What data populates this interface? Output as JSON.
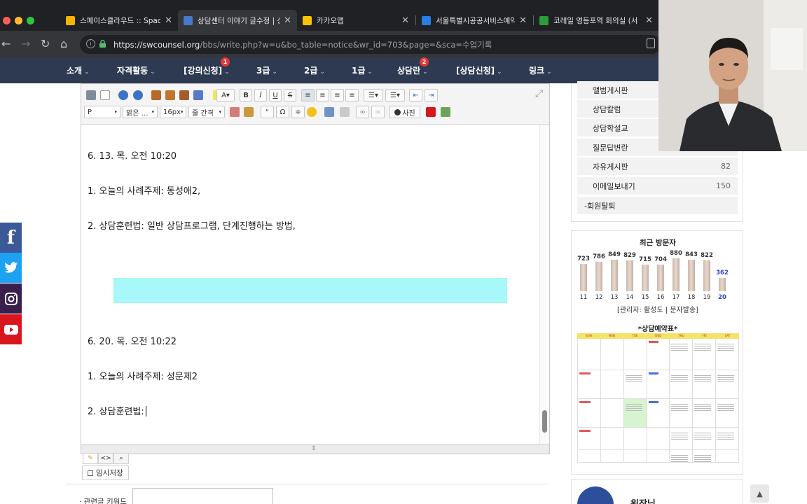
{
  "browser": {
    "tabs": [
      {
        "title": "스페이스클라우드 :: Space",
        "favicon_color": "#f5b400"
      },
      {
        "title": "상담센터 이야기 글수정 | 상",
        "favicon_color": "#4a79c9"
      },
      {
        "title": "카카오맵",
        "favicon_color": "#f7c600"
      },
      {
        "title": "서울특별시공공서비스예약",
        "favicon_color": "#2a7de1"
      },
      {
        "title": "코레일 영등포역 회의실 (서",
        "favicon_color": "#2e9b3a"
      }
    ],
    "url_domain": "https://swcounsel.org",
    "url_path": "/bbs/write.php?w=u&bo_table=notice&wr_id=703&page=&sca=수업기록"
  },
  "sitenav": {
    "items": [
      {
        "label": "소개",
        "badge": ""
      },
      {
        "label": "자격활동",
        "badge": ""
      },
      {
        "label": "[강의신청]",
        "badge": "1"
      },
      {
        "label": "3급",
        "badge": ""
      },
      {
        "label": "2급",
        "badge": ""
      },
      {
        "label": "1급",
        "badge": ""
      },
      {
        "label": "상담란",
        "badge": "2"
      },
      {
        "label": "[상담신청]",
        "badge": ""
      },
      {
        "label": "링크",
        "badge": ""
      }
    ]
  },
  "social": [
    "f",
    "t",
    "i",
    "y"
  ],
  "editor": {
    "format_select": "P",
    "font_select": "맑은 …",
    "size_select": "16px",
    "line_spacing_select": "줄 간격",
    "photo_button": "사진",
    "lines": [
      "6. 13. 목. 오전 10:20",
      "1. 오늘의 사례주제: 동성애2,",
      "2. 상담훈련법: 일반 상담프로그램, 단계진행하는 방법,",
      "6. 20. 목. 오전 10:22",
      "1. 오늘의 사례주제: 성문제2",
      "2. 상담훈련법:"
    ],
    "temp_save_label": "임시저장",
    "keyword_label": "· 관련글 키워드"
  },
  "sidebar": {
    "menu": [
      {
        "label": "앨범게시판",
        "count": ""
      },
      {
        "label": "상담칼럼",
        "count": ""
      },
      {
        "label": "상담학설교",
        "count": ""
      },
      {
        "label": "질문답변란",
        "count": ""
      },
      {
        "label": "자유게시판",
        "count": "82"
      },
      {
        "label": "이메일보내기",
        "count": "150"
      },
      {
        "label": "-회원탈퇴",
        "count": ""
      }
    ],
    "visitor_title": "최근 방문자",
    "admin_line": "[관리자: 활성도 | 문자발송]",
    "calendar_title": "*상담예약표*",
    "calendar_headers": [
      "SUN",
      "MON",
      "TUE",
      "WED",
      "THU",
      "FRI",
      "SAT"
    ],
    "bottom_name": "원장님"
  },
  "chart_data": {
    "type": "bar",
    "title": "최근 방문자",
    "categories": [
      "11",
      "12",
      "13",
      "14",
      "15",
      "16",
      "17",
      "18",
      "19",
      "20"
    ],
    "values": [
      723,
      786,
      849,
      829,
      715,
      704,
      880,
      843,
      822,
      362
    ],
    "ylim": [
      0,
      900
    ],
    "highlight_color": "#2f3fd1"
  }
}
